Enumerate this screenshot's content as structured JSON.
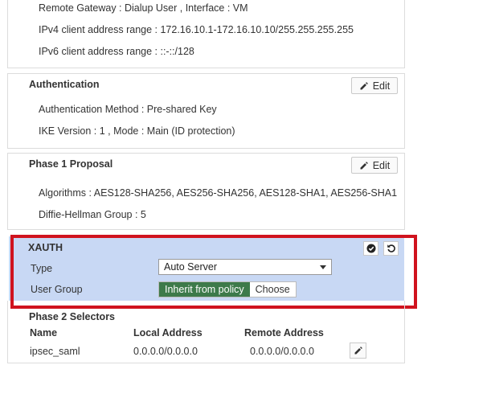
{
  "network": {
    "remote_gateway": "Remote Gateway : Dialup User , Interface : VM",
    "ipv4_range": "IPv4 client address range : 172.16.10.1-172.16.10.10/255.255.255.255",
    "ipv6_range": "IPv6 client address range : ::-::/128"
  },
  "authentication": {
    "title": "Authentication",
    "edit_label": "Edit",
    "method": "Authentication Method : Pre-shared Key",
    "ike": "IKE Version : 1 , Mode : Main (ID protection)"
  },
  "phase1": {
    "title": "Phase 1 Proposal",
    "edit_label": "Edit",
    "algorithms": "Algorithms : AES128-SHA256, AES256-SHA256, AES128-SHA1, AES256-SHA1",
    "dh_group": "Diffie-Hellman Group : 5"
  },
  "xauth": {
    "title": "XAUTH",
    "type_label": "Type",
    "type_value": "Auto Server",
    "user_group_label": "User Group",
    "inherit_label": "Inherit from policy",
    "choose_label": "Choose",
    "accent_color": "#3d7a4a",
    "highlight_color": "#d0131e"
  },
  "phase2": {
    "title": "Phase 2 Selectors",
    "headers": [
      "Name",
      "Local Address",
      "Remote Address"
    ],
    "rows": [
      {
        "name": "ipsec_saml",
        "local": "0.0.0.0/0.0.0.0",
        "remote": "0.0.0.0/0.0.0.0"
      }
    ]
  }
}
